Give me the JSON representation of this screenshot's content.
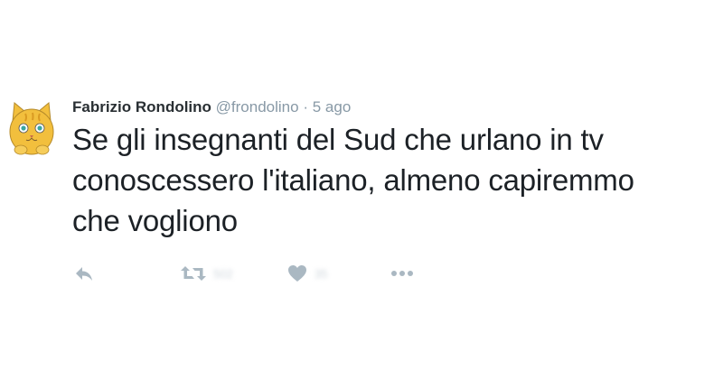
{
  "tweet": {
    "author": {
      "display_name": "Fabrizio Rondolino",
      "handle": "@frondolino",
      "separator": "·",
      "time": "5 ago",
      "avatar_icon": "cartoon-cat-avatar"
    },
    "text_lines": [
      "Se gli insegnanti del Sud che urlano in tv",
      "conoscessero l'italiano, almeno capiremmo",
      "che vogliono"
    ],
    "actions": {
      "reply_icon": "reply-icon",
      "retweet_icon": "retweet-icon",
      "retweet_count": "502",
      "like_icon": "heart-icon",
      "like_count": "35",
      "more_icon": "more-dots-icon"
    }
  },
  "colors": {
    "text": "#1c2126",
    "name": "#292f33",
    "secondary": "#8899a6",
    "icon": "#aab8c2",
    "avatar_fill": "#f2bf3d"
  }
}
